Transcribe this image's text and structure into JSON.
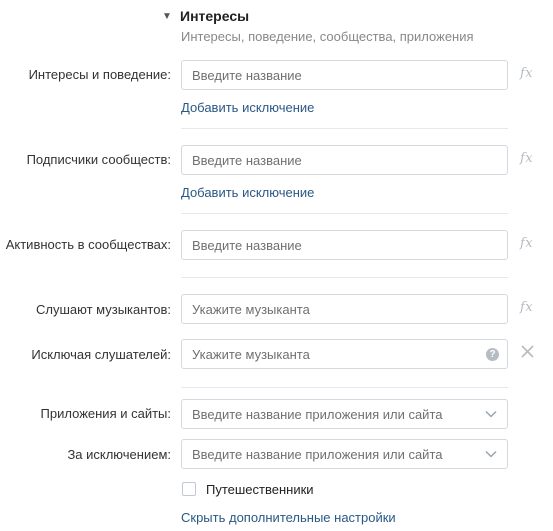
{
  "section": {
    "title": "Интересы",
    "subtitle": "Интересы, поведение, сообщества, приложения"
  },
  "fields": {
    "interests": {
      "label": "Интересы и поведение:",
      "placeholder": "Введите название",
      "exception_link": "Добавить исключение",
      "fx": "fx"
    },
    "subscribers": {
      "label": "Подписчики сообществ:",
      "placeholder": "Введите название",
      "exception_link": "Добавить исключение",
      "fx": "fx"
    },
    "activity": {
      "label": "Активность в сообществах:",
      "placeholder": "Введите название",
      "fx": "fx"
    },
    "musicians": {
      "label": "Слушают музыкантов:",
      "placeholder": "Укажите музыканта",
      "fx": "fx"
    },
    "exclude_listeners": {
      "label": "Исключая слушателей:",
      "placeholder": "Укажите музыканта",
      "help_icon": "?"
    },
    "apps": {
      "label": "Приложения и сайты:",
      "placeholder": "Введите название приложения или сайта"
    },
    "apps_except": {
      "label": "За исключением:",
      "placeholder": "Введите название приложения или сайта"
    }
  },
  "travelers": {
    "label": "Путешественники",
    "checked": false
  },
  "hide_settings_link": "Скрыть дополнительные настройки",
  "colors": {
    "link": "#2a5885",
    "border": "#d3d9de",
    "muted": "#b4bcc4"
  }
}
